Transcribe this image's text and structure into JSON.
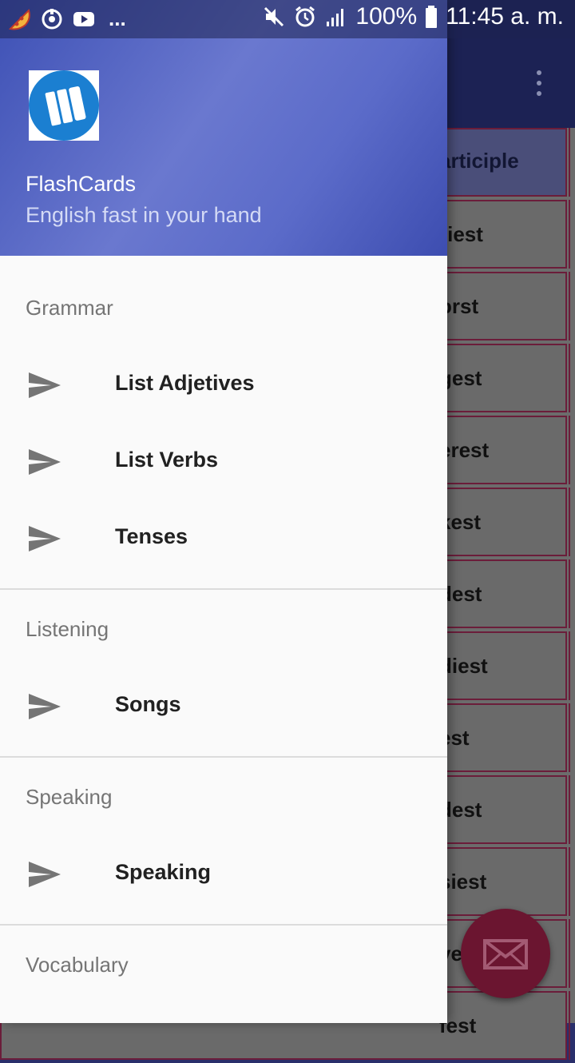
{
  "status_bar": {
    "battery": "100%",
    "time": "11:45 a. m.",
    "more_indicator": "...",
    "icons": [
      "pizza-icon",
      "sync-icon",
      "youtube-icon",
      "mute-icon",
      "alarm-icon",
      "signal-icon",
      "battery-icon"
    ]
  },
  "drawer": {
    "header": {
      "title": "FlashCards",
      "subtitle": "English fast in your hand",
      "logo_icon": "flashcards-logo-icon"
    },
    "sections": [
      {
        "title": "Grammar",
        "items": [
          {
            "label": "List Adjetives",
            "icon": "send-icon"
          },
          {
            "label": "List Verbs",
            "icon": "send-icon"
          },
          {
            "label": "Tenses",
            "icon": "send-icon"
          }
        ]
      },
      {
        "title": "Listening",
        "items": [
          {
            "label": "Songs",
            "icon": "send-icon"
          }
        ]
      },
      {
        "title": "Speaking",
        "items": [
          {
            "label": "Speaking",
            "icon": "send-icon"
          }
        ]
      },
      {
        "title": "Vocabulary",
        "items": []
      }
    ]
  },
  "background": {
    "table_header": "articiple",
    "table_cells": [
      "riest",
      "orst",
      "gest",
      "erest",
      "kest",
      "dest",
      "diest",
      "est",
      "dest",
      "siest",
      "ve",
      "fest"
    ],
    "fab_icon": "mail-icon",
    "menu_icon": "more-vert-icon"
  },
  "colors": {
    "drawer_header_start": "#3e51b5",
    "drawer_header_mid": "#6a78cf",
    "fab": "#6b1530",
    "table_border": "#6b1d3a"
  }
}
